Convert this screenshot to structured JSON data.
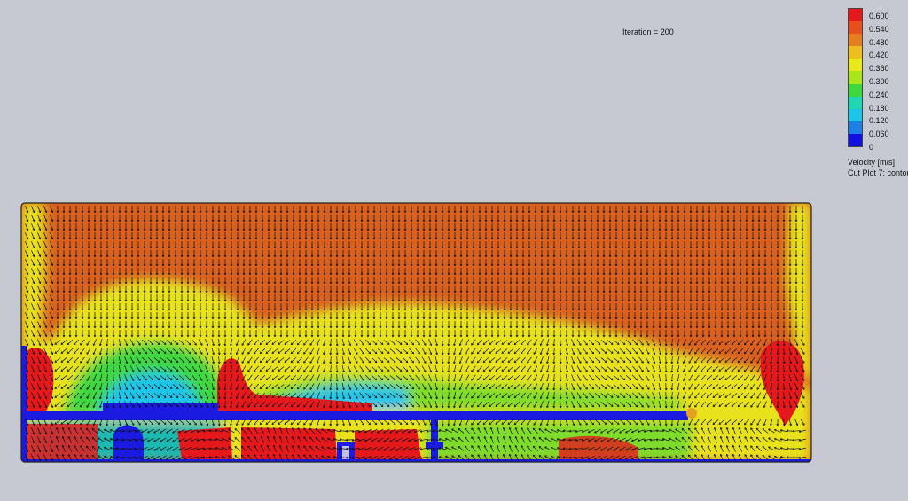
{
  "iteration_label": "Iteration = 200",
  "legend": {
    "title": "Velocity [m/s]",
    "ticks": [
      "0.600",
      "0.540",
      "0.480",
      "0.420",
      "0.360",
      "0.300",
      "0.240",
      "0.180",
      "0.120",
      "0.060",
      "0"
    ],
    "colors": [
      "#e5191b",
      "#e84f1f",
      "#e37f21",
      "#ecbf1f",
      "#e9e81d",
      "#a9e51d",
      "#3fd83f",
      "#1fd7b3",
      "#1fc5e9",
      "#1e7fe5",
      "#1010e0"
    ]
  },
  "cut_plot_label": "Cut Plot 7: contou",
  "plot": {
    "colors": {
      "high": "#e5191b",
      "orange": "#d9601f",
      "yellow": "#e8e21d",
      "green": "#3fd83f",
      "cyan": "#1fc5e9",
      "blue": "#1a1ae0",
      "arrow": "#111111"
    }
  }
}
